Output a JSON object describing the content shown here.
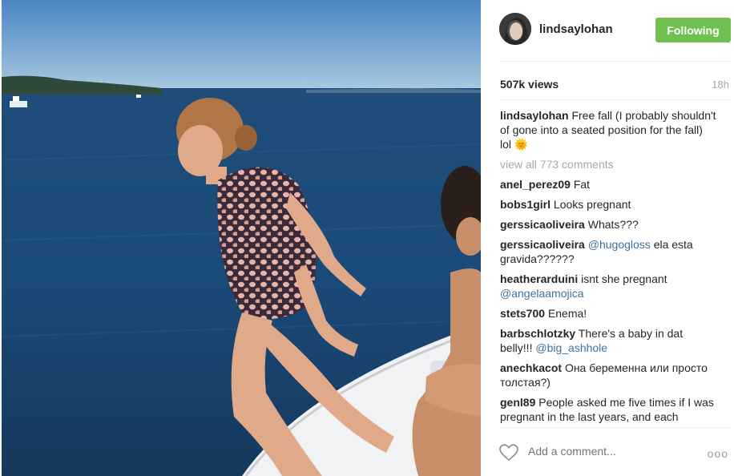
{
  "header": {
    "username": "lindsaylohan",
    "follow_label": "Following"
  },
  "stats": {
    "views": "507k views",
    "time_ago": "18h"
  },
  "caption": {
    "username": "lindsaylohan",
    "text": "Free fall (I probably shouldn't of gone into a seated position for the fall) lol 🌞"
  },
  "view_all_label": "view all 773 comments",
  "comments": [
    {
      "user": "anel_perez09",
      "text": "Fat",
      "mention": ""
    },
    {
      "user": "bobs1girl",
      "text": "Looks pregnant",
      "mention": ""
    },
    {
      "user": "gerssicaoliveira",
      "text": "Whats???",
      "mention": ""
    },
    {
      "user": "gerssicaoliveira",
      "mention": "@hugogloss",
      "text": "ela esta gravida??????"
    },
    {
      "user": "heatherarduini",
      "text": "isnt she pregnant",
      "mention": "@angelaamojica"
    },
    {
      "user": "stets700",
      "text": "Enema!",
      "mention": ""
    },
    {
      "user": "barbschlotzky",
      "text": "There's a baby in dat belly!!!",
      "mention": "@big_ashhole"
    },
    {
      "user": "anechkacot",
      "text": "Она беременна или просто толстая?)",
      "mention": ""
    },
    {
      "user": "genl89",
      "text": "People asked me five times if I was pregnant in the last years, and each",
      "mention": ""
    }
  ],
  "add_comment": {
    "placeholder": "Add a comment...",
    "more_label": "ooo"
  },
  "colors": {
    "follow_button": "#70c050",
    "mention": "#3f729b",
    "muted": "#a5a7aa"
  }
}
